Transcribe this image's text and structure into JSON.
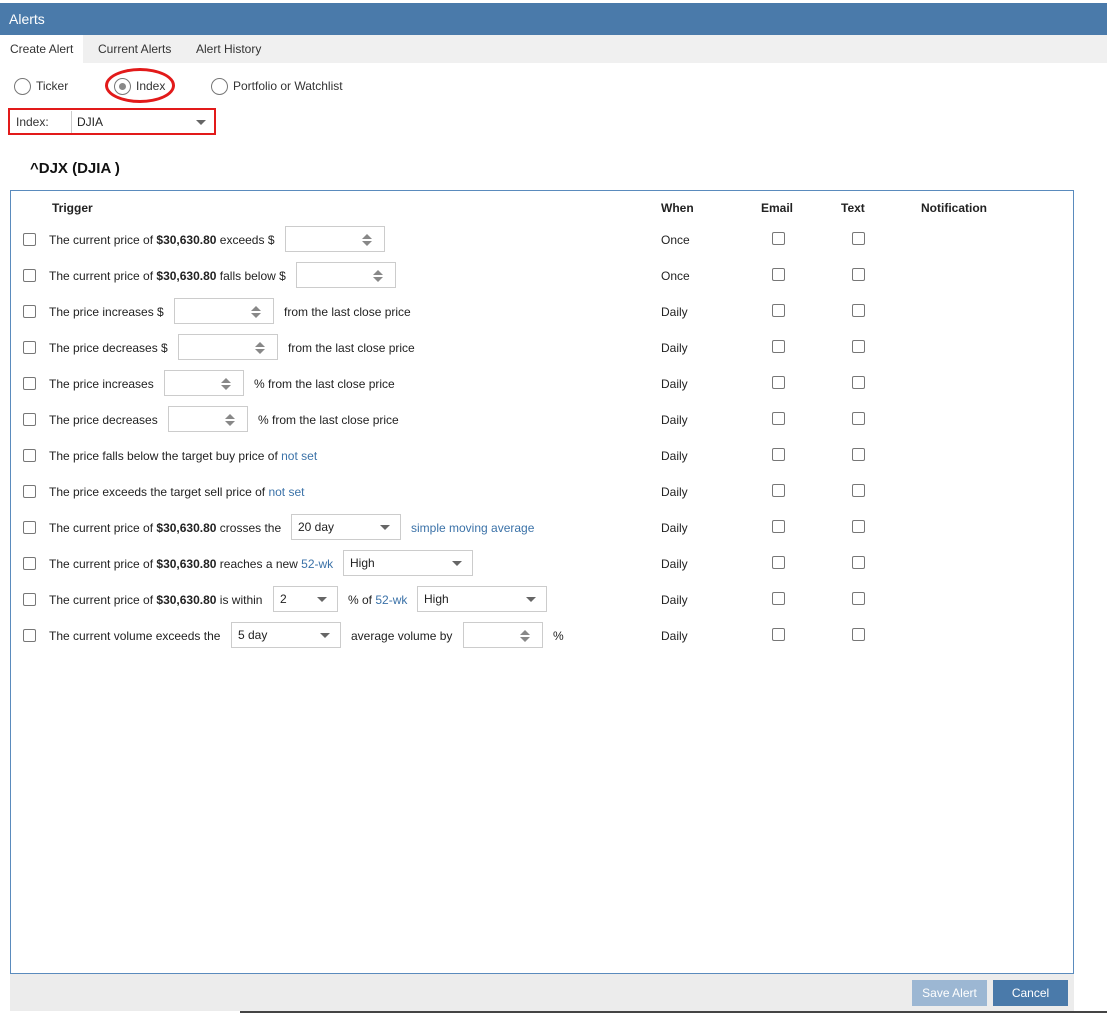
{
  "window": {
    "title": "Alerts"
  },
  "tabs": [
    {
      "label": "Create Alert",
      "active": true
    },
    {
      "label": "Current Alerts",
      "active": false
    },
    {
      "label": "Alert History",
      "active": false
    }
  ],
  "radios": [
    {
      "label": "Ticker",
      "selected": false
    },
    {
      "label": "Index",
      "selected": true
    },
    {
      "label": "Portfolio or Watchlist",
      "selected": false
    }
  ],
  "index_field": {
    "label": "Index:",
    "value": "DJIA"
  },
  "heading": "^DJX (DJIA )",
  "columns": {
    "trigger": "Trigger",
    "when": "When",
    "email": "Email",
    "text": "Text",
    "notification": "Notification"
  },
  "rows": [
    {
      "parts": [
        "The current price of ",
        "$30,630.80",
        " exceeds $"
      ],
      "when": "Once"
    },
    {
      "parts": [
        "The current price of ",
        "$30,630.80",
        " falls below $"
      ],
      "when": "Once"
    },
    {
      "parts": [
        "The price increases $",
        "from the last close price"
      ],
      "when": "Daily"
    },
    {
      "parts": [
        "The price decreases $",
        "from the last close price"
      ],
      "when": "Daily"
    },
    {
      "parts": [
        "The price increases",
        "% from the last close price"
      ],
      "when": "Daily"
    },
    {
      "parts": [
        "The price decreases",
        "% from the last close price"
      ],
      "when": "Daily"
    },
    {
      "parts": [
        "The price falls below the target buy price of ",
        "not set"
      ],
      "when": "Daily"
    },
    {
      "parts": [
        "The price exceeds the target sell price of ",
        "not set"
      ],
      "when": "Daily"
    },
    {
      "parts": [
        "The current price of ",
        "$30,630.80",
        " crosses the",
        "20 day",
        "simple moving average"
      ],
      "when": "Daily"
    },
    {
      "parts": [
        "The current price of ",
        "$30,630.80",
        " reaches a new ",
        "52-wk",
        "High"
      ],
      "when": "Daily"
    },
    {
      "parts": [
        "The current price of ",
        "$30,630.80",
        " is within",
        "2",
        "% of ",
        "52-wk",
        "High"
      ],
      "when": "Daily"
    },
    {
      "parts": [
        "The current volume exceeds the",
        "5 day",
        "average volume by",
        "%"
      ],
      "when": "Daily"
    }
  ],
  "buttons": {
    "save": "Save Alert",
    "cancel": "Cancel"
  }
}
